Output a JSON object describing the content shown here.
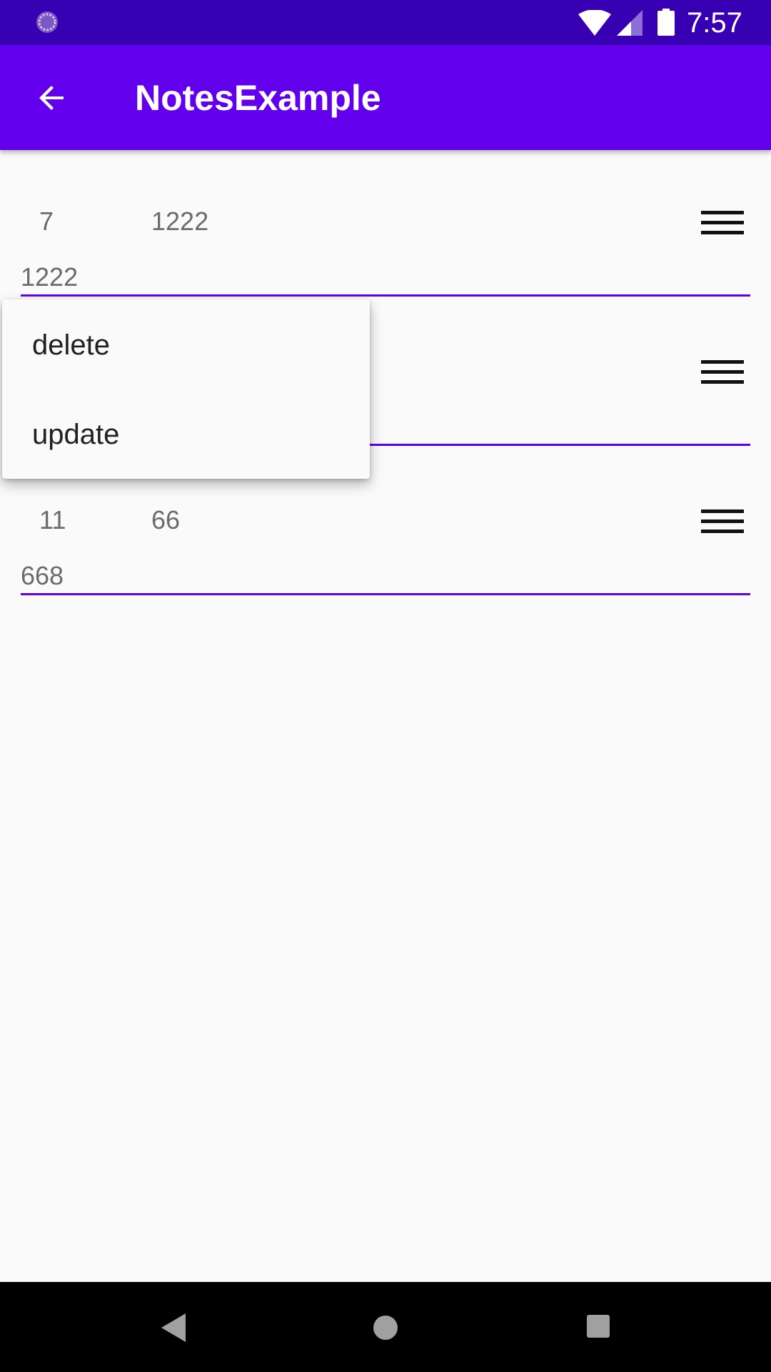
{
  "status_bar": {
    "time": "7:57",
    "icons": [
      "loading-spinner-icon",
      "wifi-icon",
      "cell-signal-icon",
      "battery-icon"
    ]
  },
  "app_bar": {
    "title": "NotesExample",
    "back_icon": "arrow-back-icon"
  },
  "notes": [
    {
      "id": "7",
      "title": "1222",
      "text": "1222"
    },
    {
      "id": "",
      "title": "",
      "text": ""
    },
    {
      "id": "11",
      "title": "66",
      "text": "668"
    }
  ],
  "popup_menu": {
    "items": [
      {
        "label": "delete"
      },
      {
        "label": "update"
      }
    ]
  },
  "nav_bar": {
    "icons": [
      "nav-back-icon",
      "nav-home-icon",
      "nav-recents-icon"
    ]
  },
  "colors": {
    "status_bar": "#3700b3",
    "app_bar": "#6200ee",
    "accent_underline": "#6200ee",
    "background": "#fafafa",
    "nav_bar": "#000000"
  }
}
